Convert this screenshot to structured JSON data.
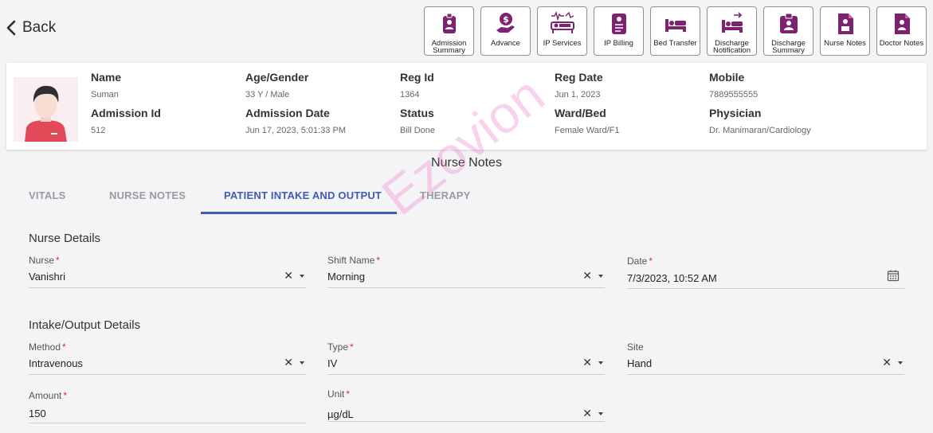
{
  "header": {
    "back_label": "Back"
  },
  "actions": [
    {
      "label": "Admission Summary",
      "icon": "id-badge-icon"
    },
    {
      "label": "Advance",
      "icon": "hand-dollar-icon"
    },
    {
      "label": "IP Services",
      "icon": "hospital-bed-pulse-icon"
    },
    {
      "label": "IP Billing",
      "icon": "billing-document-icon"
    },
    {
      "label": "Bed Transfer",
      "icon": "bed-icon"
    },
    {
      "label": "Discharge Notification",
      "icon": "bed-exit-icon"
    },
    {
      "label": "Discharge Summary",
      "icon": "clipboard-person-icon"
    },
    {
      "label": "Nurse Notes",
      "icon": "nurse-document-icon"
    },
    {
      "label": "Doctor Notes",
      "icon": "doctor-document-icon"
    }
  ],
  "patient": {
    "name_label": "Name",
    "name": "Suman",
    "age_label": "Age/Gender",
    "age": "33 Y / Male",
    "reg_label": "Reg Id",
    "reg": "1364",
    "regdate_label": "Reg Date",
    "regdate": "Jun 1, 2023",
    "mobile_label": "Mobile",
    "mobile": "7889555555",
    "admid_label": "Admission Id",
    "admid": "512",
    "admdate_label": "Admission Date",
    "admdate": "Jun 17, 2023, 5:01:33 PM",
    "status_label": "Status",
    "status": "Bill Done",
    "ward_label": "Ward/Bed",
    "ward": "Female Ward/F1",
    "physician_label": "Physician",
    "physician": "Dr. Manimaran/Cardiology"
  },
  "section_title": "Nurse Notes",
  "tabs": [
    "VITALS",
    "NURSE NOTES",
    "PATIENT INTAKE AND OUTPUT",
    "THERAPY"
  ],
  "active_tab": "PATIENT INTAKE AND OUTPUT",
  "nurse_details": {
    "heading": "Nurse Details",
    "nurse": {
      "label": "Nurse",
      "value": "Vanishri",
      "required": "*"
    },
    "shift": {
      "label": "Shift Name",
      "value": "Morning",
      "required": "*"
    },
    "date": {
      "label": "Date",
      "value": "7/3/2023, 10:52 AM",
      "required": "*"
    }
  },
  "io_details": {
    "heading": "Intake/Output Details",
    "method": {
      "label": "Method",
      "value": "Intravenous",
      "required": "*"
    },
    "type": {
      "label": "Type",
      "value": "IV",
      "required": "*"
    },
    "site": {
      "label": "Site",
      "value": "Hand"
    },
    "amount": {
      "label": "Amount",
      "value": "150",
      "required": "*"
    },
    "unit": {
      "label": "Unit",
      "value": "µg/dL",
      "required": "*"
    }
  },
  "watermark": "Ezovion",
  "colors": {
    "icon": "#7b2371",
    "accent": "#3f5bb5",
    "required": "#d32f2f"
  }
}
